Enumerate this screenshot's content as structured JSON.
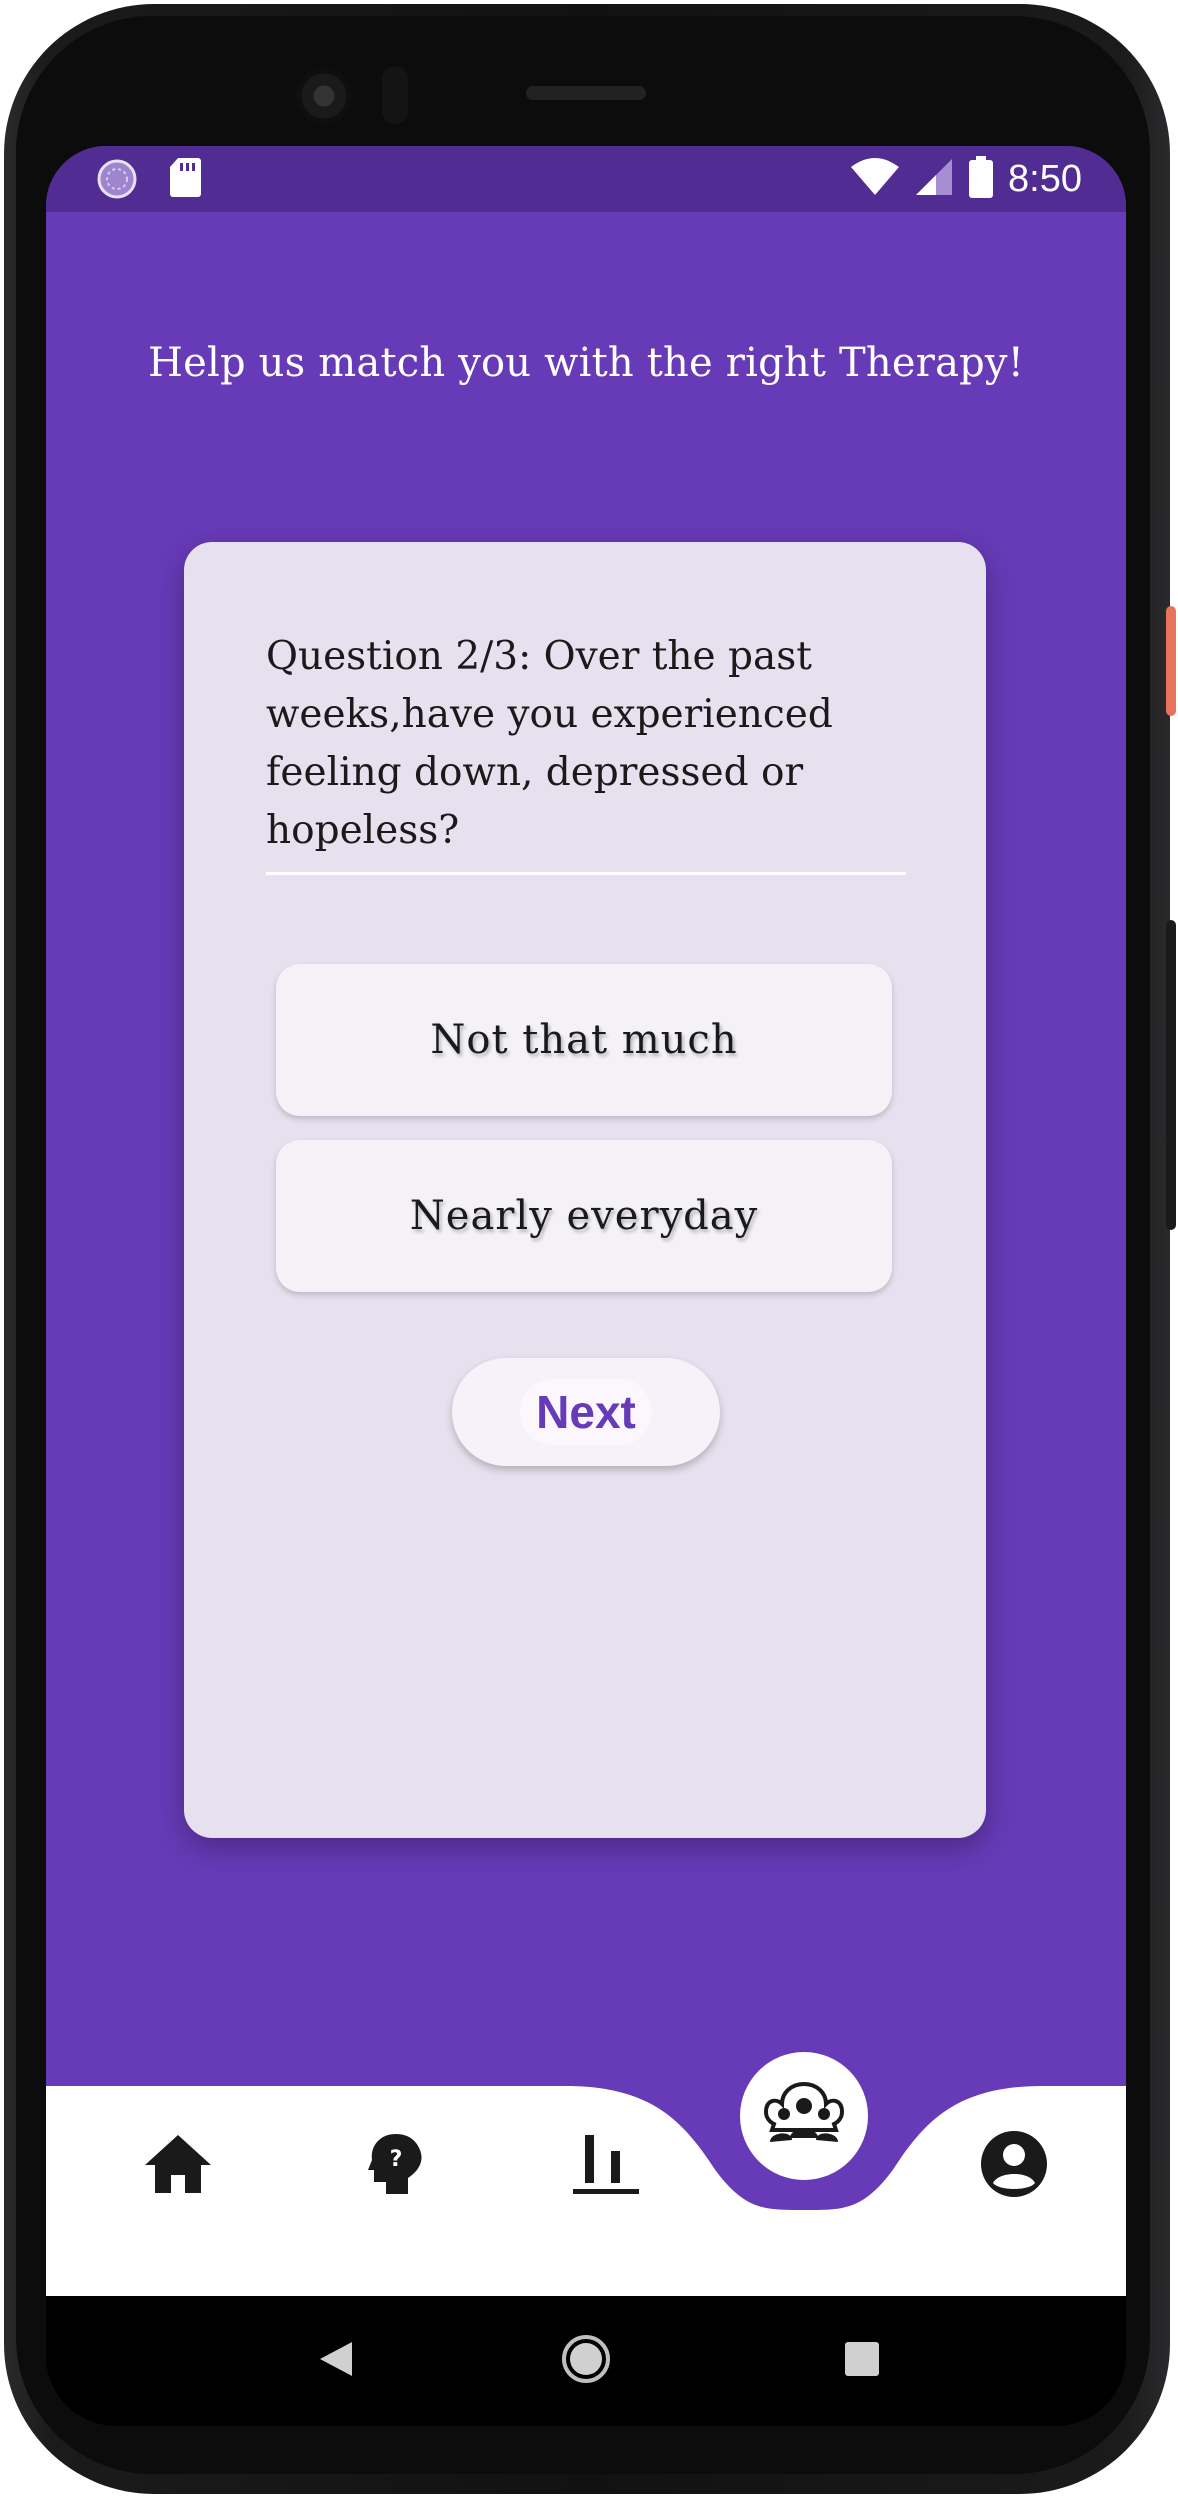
{
  "status_bar": {
    "time": "8:50",
    "left_icons": [
      "loading-indicator-icon",
      "sd-card-icon"
    ],
    "right_icons": [
      "wifi-icon",
      "cell-signal-icon",
      "battery-icon"
    ]
  },
  "header": {
    "title": "Help us match you with the right Therapy!"
  },
  "quiz": {
    "question": "Question 2/3: Over the past weeks,have you experienced feeling down, depressed or hopeless?",
    "options": [
      {
        "label": "Not that much"
      },
      {
        "label": "Nearly everyday"
      }
    ],
    "next_label": "Next"
  },
  "bottom_nav": {
    "items": [
      {
        "icon": "home-icon"
      },
      {
        "icon": "help-head-icon"
      },
      {
        "icon": "bar-chart-icon"
      },
      {
        "icon": "group-icon",
        "active": true
      },
      {
        "icon": "account-circle-icon"
      }
    ]
  },
  "system_nav": {
    "buttons": [
      "back-icon",
      "home-circle-icon",
      "recents-icon"
    ]
  },
  "colors": {
    "primary": "#673ab7",
    "status_bar": "#512c92",
    "card": "#e7e0ee",
    "option": "#f4f2f7",
    "accent_text": "#673ab7"
  }
}
